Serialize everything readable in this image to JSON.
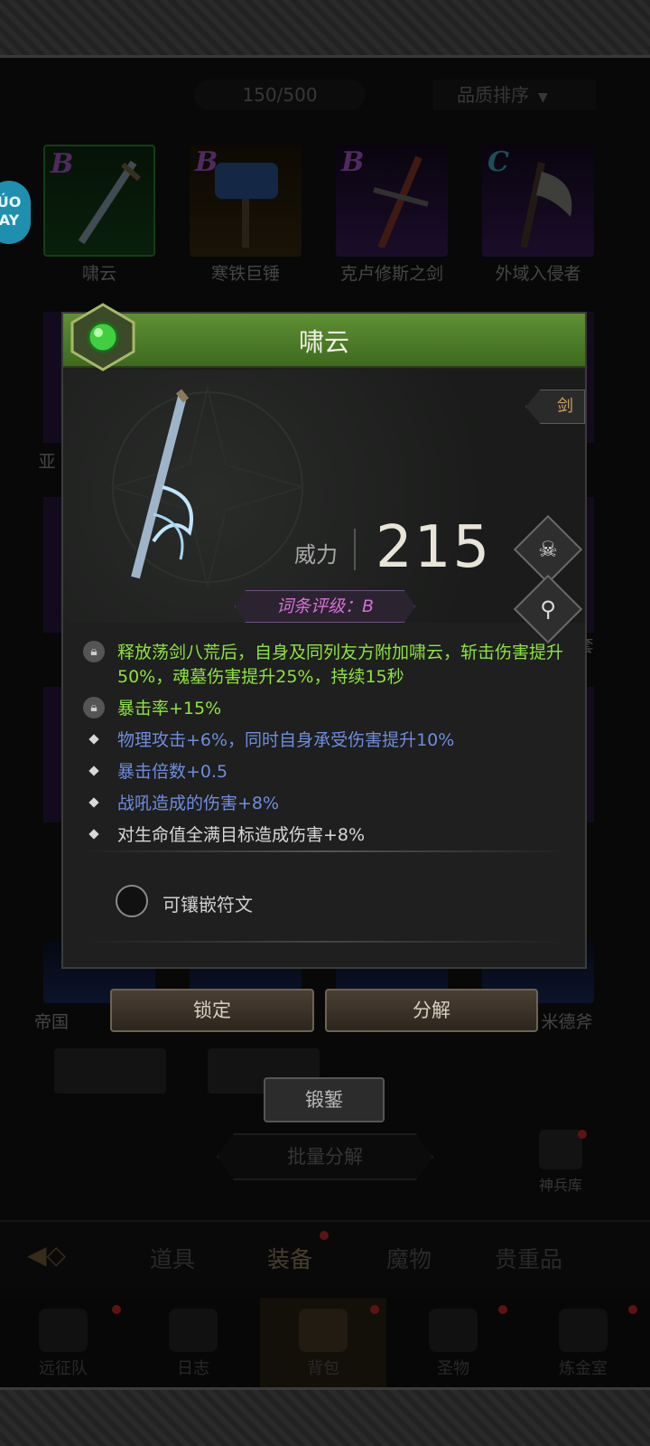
{
  "inventory": {
    "capacity": "150/500",
    "sort_label": "品质排序",
    "side_badge": "ÚO AY",
    "row1": [
      {
        "grade": "B",
        "name": "啸云",
        "rarity": "green"
      },
      {
        "grade": "B",
        "name": "寒铁巨锤",
        "rarity": "orange"
      },
      {
        "grade": "B",
        "name": "克卢修斯之剑",
        "rarity": "purple"
      },
      {
        "grade": "C",
        "name": "外域入侵者",
        "rarity": "purple"
      }
    ],
    "partial_left_label": "亚",
    "partial_right_label": "套",
    "row5_left_label": "帝国",
    "row5_right_label": "米德斧"
  },
  "popup": {
    "title": "啸云",
    "type_tag": "剑",
    "power_label": "威力",
    "power_value": "215",
    "affix_rating": "词条评级：B",
    "attributes": [
      {
        "text": "释放荡剑八荒后，自身及同列友方附加啸云，斩击伤害提升50%，魂墓伤害提升25%，持续15秒",
        "color": "green",
        "icon": "lock-icon"
      },
      {
        "text": "暴击率+15%",
        "color": "green",
        "icon": "lock-icon"
      },
      {
        "text": "物理攻击+6%，同时自身承受伤害提升10%",
        "color": "blue",
        "icon": "diamond-bullet"
      },
      {
        "text": "暴击倍数+0.5",
        "color": "blue",
        "icon": "diamond-bullet"
      },
      {
        "text": "战吼造成的伤害+8%",
        "color": "blue",
        "icon": "diamond-bullet"
      },
      {
        "text": "对生命值全满目标造成伤害+8%",
        "color": "white",
        "icon": "diamond-bullet"
      }
    ],
    "rune_label": "可镶嵌符文"
  },
  "actions": {
    "lock": "锁定",
    "decompose": "分解",
    "forge": "锻錾",
    "batch_decompose": "批量分解",
    "armory": "神兵库"
  },
  "tabs": [
    {
      "label": "道具",
      "active": false
    },
    {
      "label": "装备",
      "active": true
    },
    {
      "label": "魔物",
      "active": false
    },
    {
      "label": "贵重品",
      "active": false
    }
  ],
  "bottom_nav": [
    {
      "label": "远征队",
      "icon": "helmet-icon"
    },
    {
      "label": "日志",
      "icon": "scroll-icon"
    },
    {
      "label": "背包",
      "icon": "backpack-icon"
    },
    {
      "label": "圣物",
      "icon": "chalice-icon"
    },
    {
      "label": "炼金室",
      "icon": "alchemy-icon"
    }
  ],
  "colors": {
    "header_green": "#5f8f35",
    "attr_green": "#8fe33e",
    "attr_blue": "#6f8dde",
    "grade_purple": "#b05cd6",
    "rating_pink": "#d66fd8"
  }
}
